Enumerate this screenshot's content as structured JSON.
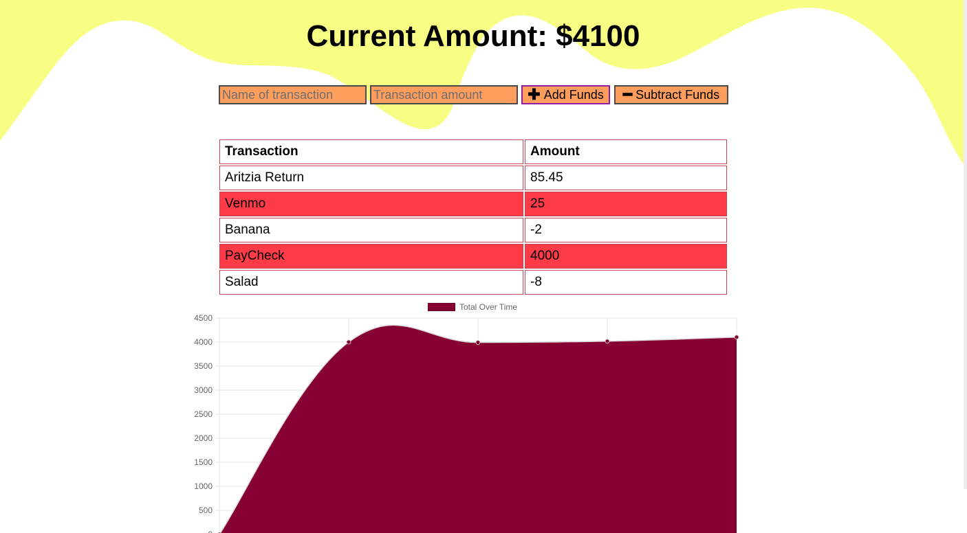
{
  "header": {
    "title": "Current Amount: $4100"
  },
  "form": {
    "name_placeholder": "Name of transaction",
    "amount_placeholder": "Transaction amount",
    "add_label": "Add Funds",
    "add_icon": "plus-icon",
    "subtract_label": "Subtract Funds",
    "subtract_icon": "minus-icon"
  },
  "table": {
    "headers": [
      "Transaction",
      "Amount"
    ],
    "rows": [
      {
        "name": "Aritzia Return",
        "amount": "85.45"
      },
      {
        "name": "Venmo",
        "amount": "25"
      },
      {
        "name": "Banana",
        "amount": "-2"
      },
      {
        "name": "PayCheck",
        "amount": "4000"
      },
      {
        "name": "Salad",
        "amount": "-8"
      }
    ]
  },
  "colors": {
    "background_wave": "#f8fd84",
    "input_fill": "#ff9e5c",
    "row_highlight": "#ff3b47",
    "series_fill": "#870034"
  },
  "chart_data": {
    "type": "area",
    "legend": "top-center",
    "grid": true,
    "series": [
      {
        "name": "Total Over Time",
        "values": [
          0,
          4000,
          3992,
          4017,
          4102.45
        ]
      }
    ],
    "ylim": [
      0,
      4500
    ],
    "y_ticks": [
      "0",
      "500",
      "1000",
      "1500",
      "2000",
      "2500",
      "3000",
      "3500",
      "4000",
      "4500"
    ]
  }
}
